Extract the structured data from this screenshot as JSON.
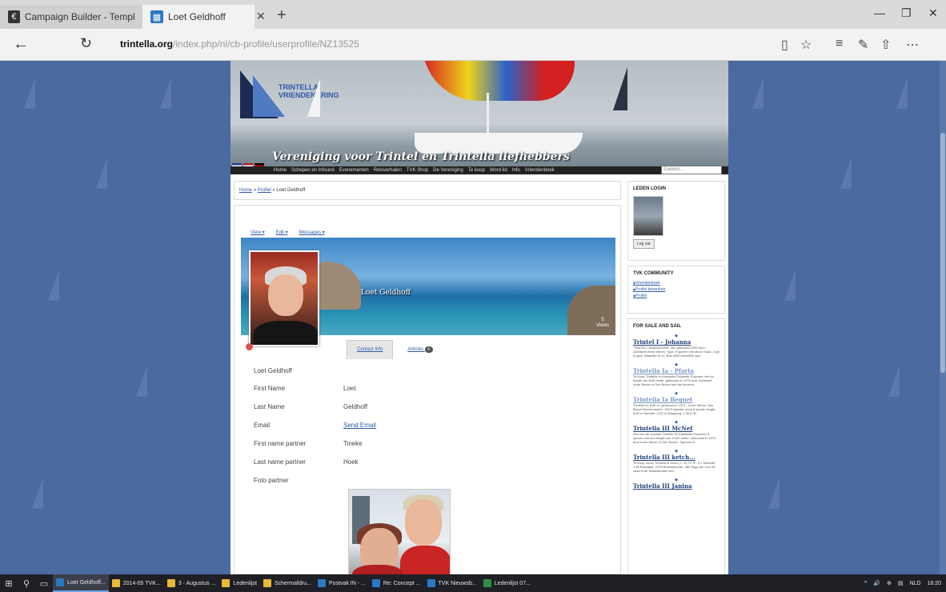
{
  "browser": {
    "tabs": [
      {
        "title": "Campaign Builder - Templat",
        "favicon": "wordmark-icon"
      },
      {
        "title": "Loet Geldhoff",
        "favicon": "site-icon"
      }
    ],
    "url_host": "trintella.org",
    "url_path": "/index.php/nl/cb-profile/userprofile/NZ13525"
  },
  "site": {
    "logo_line1": "TRINTELLA",
    "logo_line2": "VRIENDENKRING",
    "tagline": "Vereniging voor Trintel en Trintella liefhebbers",
    "menu": [
      "Home",
      "Schepen en Infound",
      "Evenementen",
      "Reisverhalen",
      "TVK Shop",
      "De Vereniging",
      "Te koop",
      "Word lid",
      "Info",
      "Vriendenboek"
    ],
    "search_placeholder": "Zoeken..."
  },
  "breadcrumb": {
    "home": "Home",
    "sep": "»",
    "profile": "Profiel",
    "current": "Loet Geldhoff"
  },
  "profile": {
    "menu": [
      "View ▾",
      "Edit ▾",
      "Messages ▾"
    ],
    "name": "Loet Geldhoff",
    "views_count": "5",
    "views_label": "Views",
    "tabs": [
      {
        "label": "Contact Info"
      },
      {
        "label": "Articles",
        "badge": "0"
      }
    ],
    "heading": "Loet Geldhoff",
    "fields": [
      {
        "label": "First Name",
        "value": "Loet"
      },
      {
        "label": "Last Name",
        "value": "Geldhoff"
      },
      {
        "label": "Email",
        "value": "Send Email"
      },
      {
        "label": "First name partner",
        "value": "Tineke"
      },
      {
        "label": "Last name partner",
        "value": "Hoek"
      },
      {
        "label": "Foto partner",
        "value": ""
      }
    ]
  },
  "sidebar": {
    "login_title": "LEDEN LOGIN",
    "logout_label": "Log out",
    "community_title": "TVK COMMUNITY",
    "community_links": [
      "Vriendenboek",
      "Profiel bewerken",
      "Profiel"
    ],
    "sale_title": "FOR SALE AND SAIL",
    "sale_items": [
      {
        "title": "Trintel I - Johanna",
        "desc": "TRINTEL I Bouwnummer: 362 gebouwd 1962 door Jachtwerf Anne Wever. Type: 5 sporen met stuur. Klaar: 2 pijl in gele, Waterlijn 31 m. Bas 0000 hetzelfde vaa..."
      },
      {
        "title": "Trintella Ia - Pfarta",
        "desc": "Te koop: Trintella Ia Klassieke Polyester 5 sporen met tot lengte van 8,60 meter, gebouwd in 1970 door Jachtwerf Anne Wever in Den Bosch met als bouwnu..."
      },
      {
        "title": "Trintella Ia Bequet",
        "desc": "Trintella Ia, 8,80 m, gebouwd in 1971 - Anne Wever, Den Bosch Bouwnummer: 153 Polyester romp 5 sporen lengte: 8,60 m Breedte: 2,52 m Diepgang: 1,30 m B..."
      },
      {
        "title": "Trintella III McNef",
        "desc": "Een van de mooiste Trintella 32 Klassieke Polyester 5 sporen met een lengte van 10,60 meter. Gebouwd in 1975 door Anne Wever in Den Bosch. Typhoon N..."
      },
      {
        "title": "Trintella III ketch...",
        "desc": "Te koop: ketch Trintella III ketch (1. 10,70 'S'- 3,1 'Breedte'. 1,45 Bouwjaar: 1976 Bouwnummer: 360 Rigg ook voor de zaad in de Middellandse zee..."
      },
      {
        "title": "Trintella III Janina",
        "desc": ""
      }
    ]
  },
  "taskbar": {
    "items": [
      {
        "label": "Loet Geldhoff...",
        "active": true,
        "color": "#2b78c5"
      },
      {
        "label": "2014-05 TVK...",
        "active": false,
        "color": "#e8b93a"
      },
      {
        "label": "3 - Augustus ...",
        "active": false,
        "color": "#e8b93a"
      },
      {
        "label": "Ledenlijst",
        "active": false,
        "color": "#e8b93a"
      },
      {
        "label": "Schermafdru...",
        "active": false,
        "color": "#e8b93a"
      },
      {
        "label": "Postvak IN - ...",
        "active": false,
        "color": "#2b78c5"
      },
      {
        "label": "Re: Concept ...",
        "active": false,
        "color": "#2b78c5"
      },
      {
        "label": "TVK Nieuwsb...",
        "active": false,
        "color": "#2b78c5"
      },
      {
        "label": "Ledenlijst 07...",
        "active": false,
        "color": "#2f8f3e"
      }
    ],
    "language": "NLD",
    "time": "18:20"
  }
}
